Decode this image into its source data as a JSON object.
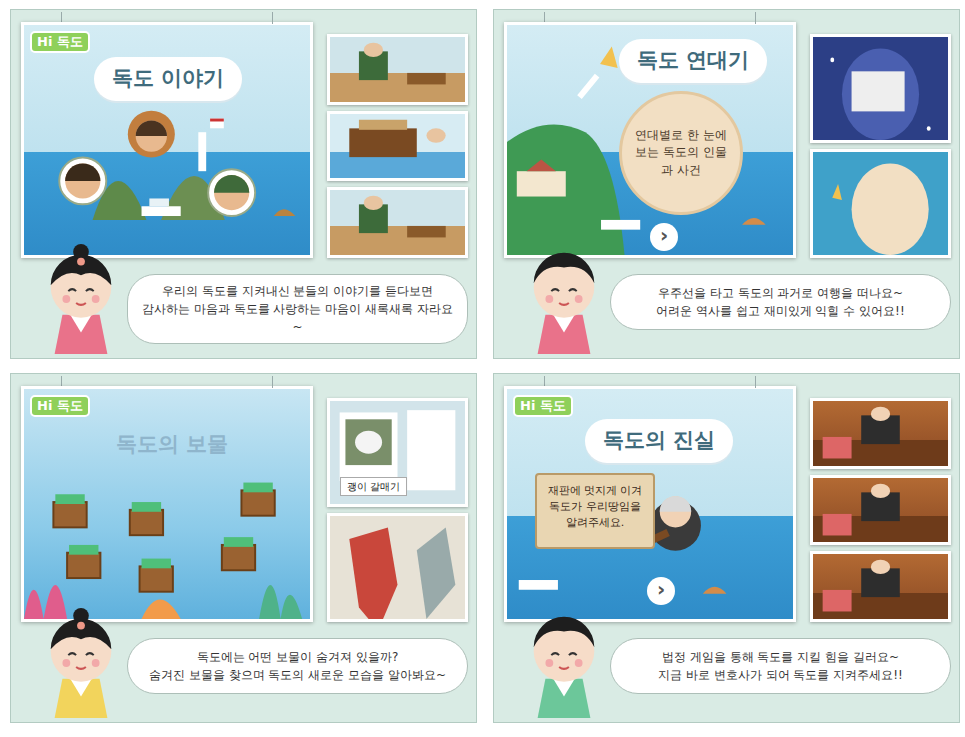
{
  "panels": [
    {
      "logo": "Hi 독도",
      "title": "독도 이야기",
      "screen_kind": "story",
      "character": {
        "kind": "girl",
        "color": "#e9728a"
      },
      "bubble": [
        "우리의 독도를 지켜내신 분들의 이야기를 듣다보면",
        "감사하는 마음과 독도를 사랑하는 마음이 새록새록 자라요~"
      ],
      "thumbs": [
        {
          "kind": "room"
        },
        {
          "kind": "ship"
        },
        {
          "kind": "room"
        }
      ]
    },
    {
      "title": "독도 연대기",
      "screen_kind": "timeline",
      "screen_text": "연대별로 한 눈에 보는 독도의 인물과 사건",
      "next_icon": "›",
      "character": {
        "kind": "boy",
        "color": "#e9728a"
      },
      "bubble": [
        "우주선을 타고 독도의 과거로 여행을 떠나요~",
        "어려운 역사를 쉽고 재미있게 익힐 수 있어요!!"
      ],
      "thumbs": [
        {
          "kind": "space"
        },
        {
          "kind": "space2"
        }
      ]
    },
    {
      "logo": "Hi 독도",
      "title": "독도의 보물",
      "screen_kind": "treasure",
      "character": {
        "kind": "girl",
        "color": "#f2d45c"
      },
      "bubble": [
        "독도에는 어떤 보물이 숨겨져 있을까?",
        "숨겨진 보물을 찾으며 독도의 새로운 모습을 알아봐요~"
      ],
      "thumbs": [
        {
          "kind": "photo",
          "caption": "괭이 갈매기"
        },
        {
          "kind": "map"
        }
      ]
    },
    {
      "logo": "Hi 독도",
      "title": "독도의 진실",
      "screen_kind": "court",
      "screen_text": "재판에 멋지게 이겨 독도가 우리땅임을 알려주세요.",
      "next_icon": "›",
      "character": {
        "kind": "boy",
        "color": "#6cc79a"
      },
      "bubble": [
        "법정 게임을 통해 독도를 지킬 힘을 길러요~",
        "지금 바로 변호사가 되어 독도를 지켜주세요!!"
      ],
      "thumbs": [
        {
          "kind": "court"
        },
        {
          "kind": "court"
        },
        {
          "kind": "court"
        }
      ]
    }
  ]
}
